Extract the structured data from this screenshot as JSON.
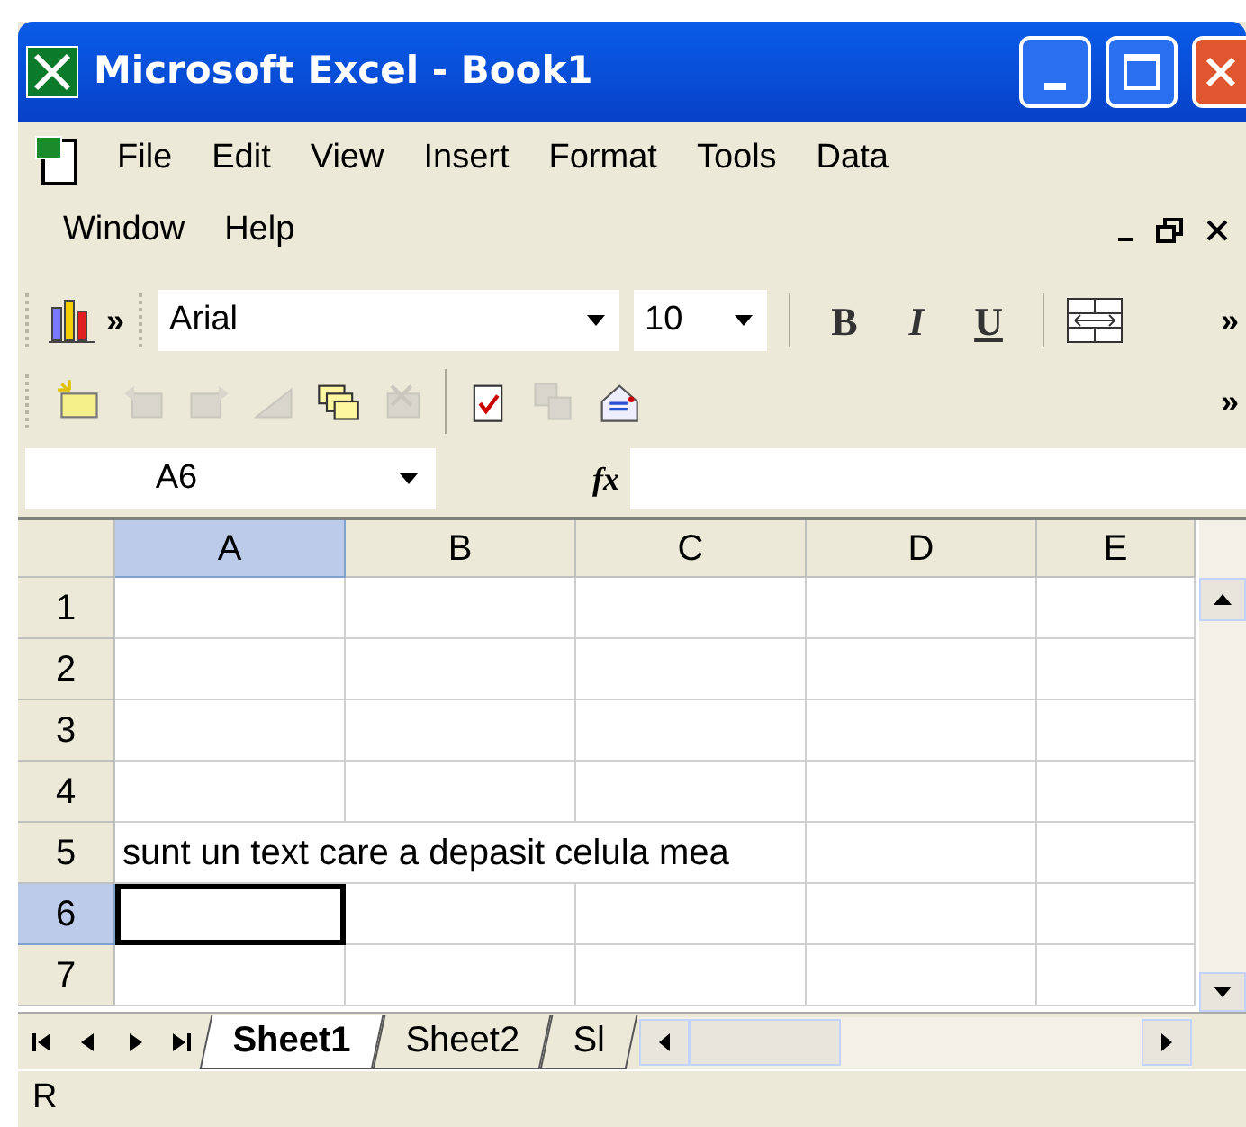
{
  "window": {
    "title": "Microsoft Excel - Book1"
  },
  "menu": {
    "items": [
      "File",
      "Edit",
      "View",
      "Insert",
      "Format",
      "Tools",
      "Data",
      "Window",
      "Help"
    ]
  },
  "formatting_toolbar": {
    "font": "Arial",
    "size": "10",
    "bold": "B",
    "italic": "I",
    "underline": "U",
    "overflow": "»"
  },
  "chart_toolbar": {
    "overflow": "»"
  },
  "standard_toolbar": {
    "buttons": [
      {
        "disabled": false
      },
      {
        "disabled": true
      },
      {
        "disabled": true
      },
      {
        "disabled": true
      },
      {
        "disabled": false
      },
      {
        "disabled": true
      },
      {
        "disabled": false
      },
      {
        "disabled": true
      },
      {
        "disabled": false
      }
    ],
    "overflow": "»"
  },
  "formula_bar": {
    "name_box": "A6",
    "fx": "fx"
  },
  "sheet": {
    "columns": [
      {
        "label": "A",
        "selected": true
      },
      {
        "label": "B",
        "selected": false
      },
      {
        "label": "C",
        "selected": false
      },
      {
        "label": "D",
        "selected": false
      },
      {
        "label": "E",
        "selected": false
      }
    ],
    "rows": [
      {
        "label": "1",
        "selected": false
      },
      {
        "label": "2",
        "selected": false
      },
      {
        "label": "3",
        "selected": false
      },
      {
        "label": "4",
        "selected": false
      },
      {
        "label": "5",
        "selected": false,
        "text": "sunt un text care a depasit celula mea"
      },
      {
        "label": "6",
        "selected": true
      },
      {
        "label": "7",
        "selected": false
      }
    ]
  },
  "sheet_tabs": [
    {
      "label": "Sheet1",
      "selected": true
    },
    {
      "label": "Sheet2",
      "selected": false
    },
    {
      "label": "Sl",
      "selected": false
    }
  ],
  "status_bar": {
    "text": "R"
  }
}
